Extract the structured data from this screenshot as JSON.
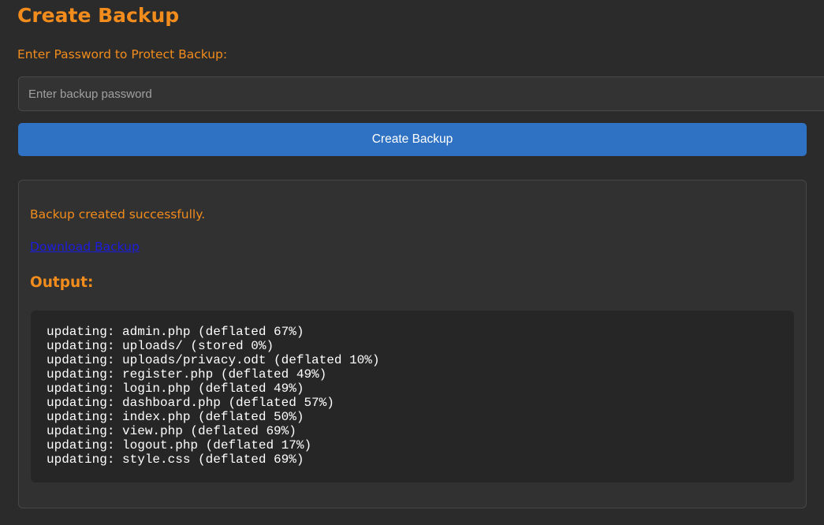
{
  "title": "Create Backup",
  "form": {
    "password_label": "Enter Password to Protect Backup:",
    "password_placeholder": "Enter backup password",
    "password_value": "",
    "submit_label": "Create Backup"
  },
  "result": {
    "message": "Backup created successfully.",
    "download_label": "Download Backup",
    "output_heading": "Output:",
    "output_lines": [
      "updating: admin.php (deflated 67%)",
      "updating: uploads/ (stored 0%)",
      "updating: uploads/privacy.odt (deflated 10%)",
      "updating: register.php (deflated 49%)",
      "updating: login.php (deflated 49%)",
      "updating: dashboard.php (deflated 57%)",
      "updating: index.php (deflated 50%)",
      "updating: view.php (deflated 69%)",
      "updating: logout.php (deflated 17%)",
      "updating: style.css (deflated 69%)"
    ]
  },
  "colors": {
    "background": "#2b2b2b",
    "accent_orange": "#f28c1c",
    "button_blue": "#2f72c3",
    "link_blue": "#1d1de0",
    "output_bg": "#262626"
  }
}
